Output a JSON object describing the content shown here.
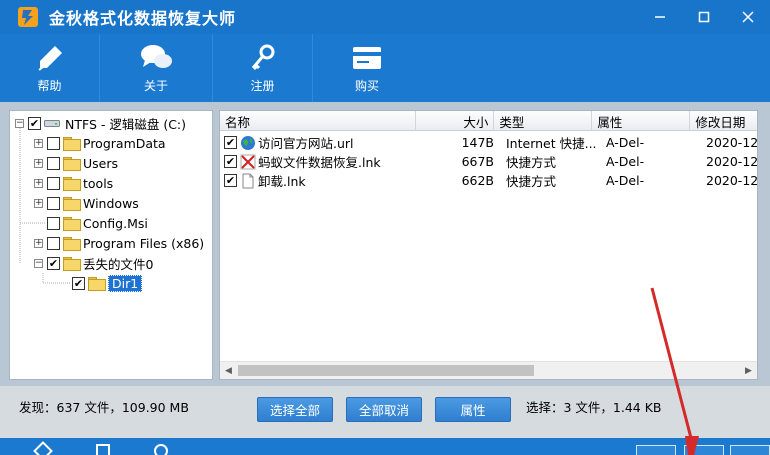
{
  "window": {
    "title": "金秋格式化数据恢复大师",
    "controls": [
      "minimize",
      "maximize",
      "close"
    ]
  },
  "toolbar": {
    "items": [
      {
        "label": "帮助",
        "icon": "pen-help-icon"
      },
      {
        "label": "关于",
        "icon": "chat-bubbles-icon"
      },
      {
        "label": "注册",
        "icon": "key-icon"
      },
      {
        "label": "购买",
        "icon": "card-icon"
      }
    ]
  },
  "tree": {
    "root": {
      "label": "NTFS - 逻辑磁盘 (C:)",
      "checked": true
    },
    "children": [
      {
        "label": "ProgramData",
        "checked": false,
        "expandable": true
      },
      {
        "label": "Users",
        "checked": false,
        "expandable": true
      },
      {
        "label": "tools",
        "checked": false,
        "expandable": true
      },
      {
        "label": "Windows",
        "checked": false,
        "expandable": true
      },
      {
        "label": "Config.Msi",
        "checked": false,
        "expandable": false
      },
      {
        "label": "Program Files (x86)",
        "checked": false,
        "expandable": true
      },
      {
        "label": "丢失的文件0",
        "checked": true,
        "expandable": true,
        "expanded": true
      }
    ],
    "selected": {
      "label": "Dir1",
      "checked": true
    }
  },
  "file_list": {
    "columns": [
      "名称",
      "大小",
      "类型",
      "属性",
      "修改日期"
    ],
    "rows": [
      {
        "name": "访问官方网站.url",
        "size": "147B",
        "type": "Internet 快捷...",
        "attr": "A-Del-",
        "date": "2020-12-",
        "icon": "globe-icon",
        "checked": true
      },
      {
        "name": "蚂蚁文件数据恢复.lnk",
        "size": "667B",
        "type": "快捷方式",
        "attr": "A-Del-",
        "date": "2020-12-",
        "icon": "broken-link-icon",
        "checked": true
      },
      {
        "name": "卸载.lnk",
        "size": "662B",
        "type": "快捷方式",
        "attr": "A-Del-",
        "date": "2020-12-",
        "icon": "file-icon",
        "checked": true
      }
    ]
  },
  "status": {
    "found": "发现：637 文件，109.90 MB",
    "selected": "选择：3 文件，1.44 KB"
  },
  "buttons": {
    "select_all": "选择全部",
    "deselect_all": "全部取消",
    "properties": "属性"
  },
  "colors": {
    "title_bar": "#1875c9",
    "toolbar": "#1b7ad0",
    "button": "#3a89d8",
    "annotation_arrow": "#d42a2a"
  }
}
